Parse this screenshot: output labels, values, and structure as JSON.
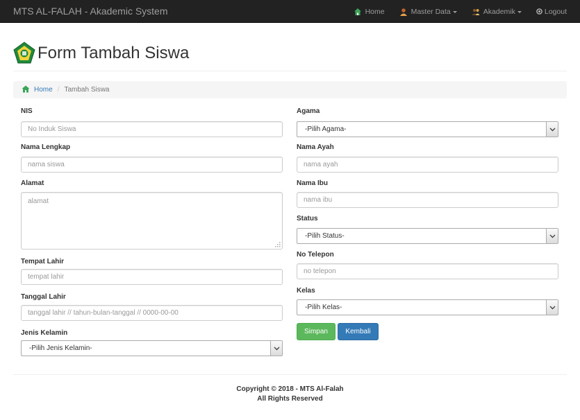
{
  "navbar": {
    "brand": "MTS AL-FALAH - Akademic System",
    "items": [
      {
        "label": "Home",
        "icon": "home-icon",
        "dropdown": false
      },
      {
        "label": "Master Data",
        "icon": "user-icon",
        "dropdown": true
      },
      {
        "label": "Akademik",
        "icon": "users-icon",
        "dropdown": true
      },
      {
        "label": "Logout",
        "icon": "power-icon",
        "dropdown": false
      }
    ]
  },
  "header": {
    "title": "Form Tambah Siswa"
  },
  "breadcrumb": {
    "home": "Home",
    "current": "Tambah Siswa"
  },
  "form": {
    "nis": {
      "label": "NIS",
      "placeholder": "No Induk Siswa"
    },
    "nama": {
      "label": "Nama Lengkap",
      "placeholder": "nama siswa"
    },
    "alamat": {
      "label": "Alamat",
      "placeholder": "alamat"
    },
    "tempat_lahir": {
      "label": "Tempat Lahir",
      "placeholder": "tempat lahir"
    },
    "tanggal_lahir": {
      "label": "Tanggal Lahir",
      "placeholder": "tanggal lahir // tahun-bulan-tanggal // 0000-00-00"
    },
    "jenis_kelamin": {
      "label": "Jenis Kelamin",
      "selected": "-Pilih Jenis Kelamin-"
    },
    "agama": {
      "label": "Agama",
      "selected": "-Pilih Agama-"
    },
    "nama_ayah": {
      "label": "Nama Ayah",
      "placeholder": "nama ayah"
    },
    "nama_ibu": {
      "label": "Nama Ibu",
      "placeholder": "nama ibu"
    },
    "status": {
      "label": "Status",
      "selected": "-Pilih Status-"
    },
    "telepon": {
      "label": "No Telepon",
      "placeholder": "no telepon"
    },
    "kelas": {
      "label": "Kelas",
      "selected": "-Pilih Kelas-"
    },
    "buttons": {
      "save": "Simpan",
      "back": "Kembali"
    }
  },
  "footer": {
    "line1": "Copyright © 2018 - MTS Al-Falah",
    "line2": "All Rights Reserved"
  },
  "colors": {
    "navbar": "#222222",
    "success": "#5cb85c",
    "primary": "#337ab7",
    "link": "#337ab7"
  }
}
